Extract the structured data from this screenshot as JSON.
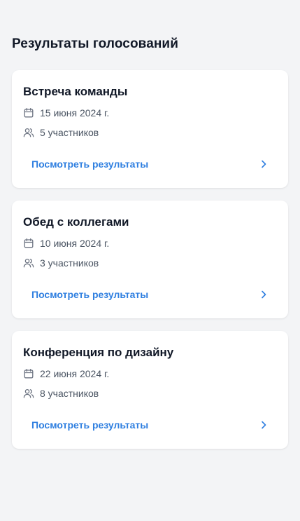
{
  "header": {
    "title": "Результаты голосований"
  },
  "polls": [
    {
      "title": "Встреча команды",
      "date": "15 июня 2024 г.",
      "participants": "5 участников",
      "link_label": "Посмотреть результаты"
    },
    {
      "title": "Обед с коллегами",
      "date": "10 июня 2024 г.",
      "participants": "3 участников",
      "link_label": "Посмотреть результаты"
    },
    {
      "title": "Конференция по дизайну",
      "date": "22 июня 2024 г.",
      "participants": "8 участников",
      "link_label": "Посмотреть результаты"
    }
  ],
  "icons": {
    "date": "calendar-icon",
    "participants": "users-icon",
    "link": "chevron-right-icon"
  },
  "colors": {
    "background": "#f3f4f6",
    "card": "#ffffff",
    "accent": "#2f7fe0",
    "text_primary": "#111827",
    "text_secondary": "#4b5563"
  }
}
